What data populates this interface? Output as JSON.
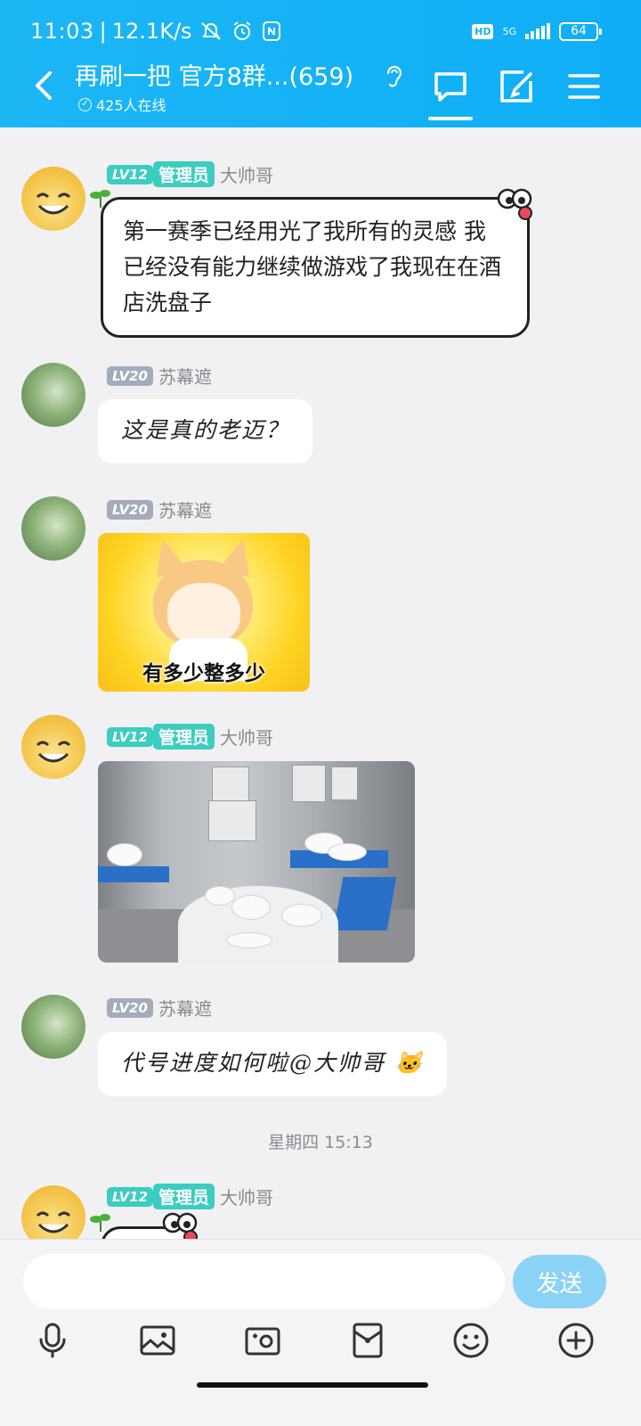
{
  "status_bar": {
    "time": "11:03",
    "network_speed": "12.1K/s",
    "network_type": "5G",
    "hd_badge": "HD",
    "battery": "64",
    "icons": [
      "mute-icon",
      "alarm-icon",
      "nfc-icon"
    ]
  },
  "header": {
    "title": "再刷一把 官方8群...(659)",
    "online_count": "425人在线",
    "icons": [
      "back-arrow-icon",
      "hearing-icon",
      "chat-icon",
      "edit-icon",
      "menu-icon"
    ]
  },
  "messages": [
    {
      "type": "text",
      "sender": "大帅哥",
      "level": "LV12",
      "role": "管理员",
      "avatar": "sun-smiley",
      "bubble_style": "comic",
      "text": "第一赛季已经用光了我所有的灵感 我已经没有能力继续做游戏了我现在在酒店洗盘子"
    },
    {
      "type": "text",
      "sender": "苏幕遮",
      "level": "LV20",
      "role": "",
      "avatar": "flower",
      "text": "这是真的老迈？"
    },
    {
      "type": "sticker",
      "sender": "苏幕遮",
      "level": "LV20",
      "role": "",
      "avatar": "flower",
      "sticker_caption": "有多少整多少"
    },
    {
      "type": "image",
      "sender": "大帅哥",
      "level": "LV12",
      "role": "管理员",
      "avatar": "sun-smiley",
      "image_desc": "hotel-dishwashing-photo"
    },
    {
      "type": "text",
      "sender": "苏幕遮",
      "level": "LV20",
      "role": "",
      "avatar": "flower",
      "text": "代号进度如何啦@大帅哥 🐱"
    },
    {
      "type": "partial",
      "sender": "大帅哥",
      "level": "LV12",
      "role": "管理员",
      "avatar": "sun-smiley"
    }
  ],
  "date_separator": "星期四 15:13",
  "input": {
    "placeholder": "",
    "send_label": "发送"
  },
  "toolbar": [
    "microphone-icon",
    "photo-icon",
    "camera-icon",
    "red-packet-icon",
    "emoji-icon",
    "plus-icon"
  ],
  "colors": {
    "header": "#13b2f6",
    "admin_badge": "#3ccdc1",
    "level_badge_gray": "#a4abba",
    "send_button": "#8bd2f7",
    "background": "#f1f1f3"
  }
}
